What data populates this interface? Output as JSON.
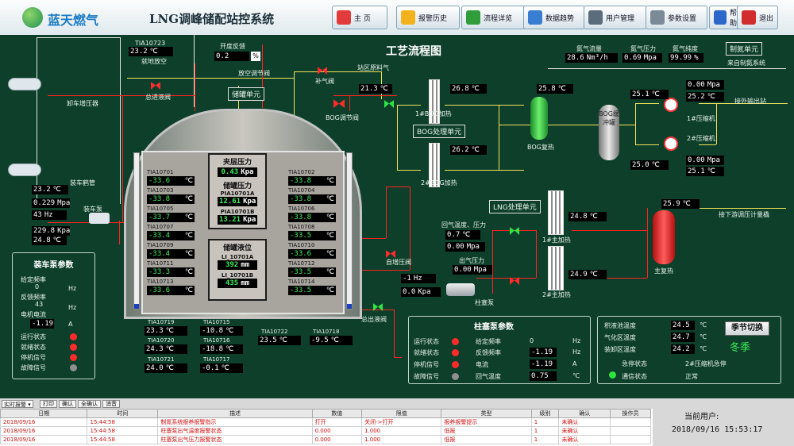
{
  "header": {
    "brand": "蓝天燃气",
    "title": "LNG调峰储配站控系统",
    "nav": [
      {
        "label": "主 页",
        "icon": "home-icon",
        "color": "#e23b3b"
      },
      {
        "label": "报警历史",
        "icon": "warning-icon",
        "color": "#f2b21b"
      },
      {
        "label": "流程详览",
        "icon": "process-icon",
        "color": "#2f9d3a"
      },
      {
        "label": "数据趋势",
        "icon": "trend-icon",
        "color": "#3a7ed1"
      },
      {
        "label": "用户管理",
        "icon": "user-icon",
        "color": "#5b6c7a"
      },
      {
        "label": "参数设置",
        "icon": "gear-icon",
        "color": "#7a8a96"
      },
      {
        "label": "帮助",
        "icon": "help-icon",
        "color": "#2d67c9"
      },
      {
        "label": "退出",
        "icon": "exit-icon",
        "color": "#d12d2d"
      }
    ]
  },
  "diagram": {
    "title": "工艺流程图",
    "tank_unit": "储罐单元",
    "bog_unit": "BOG处理单元",
    "lng_unit": "LNG处理单元",
    "n2_unit": "制氮单元",
    "n2_from": "来自制氮系统",
    "unload_press": "卸车增压器",
    "unload_arm": "装车鹤管",
    "unload_pump": "装车泵",
    "tank_valve": "总进液阀",
    "tank_out_valve": "总出液阀",
    "vent": "就地放空",
    "vent_valve": "放空调节阀",
    "aperture_label": "开度反馈",
    "aperture_val": "0.2",
    "aperture_unit": "%",
    "supp_valve": "补气阀",
    "bog_valve": "BOG调节阀",
    "station_gas": "站区原料气",
    "self_valve": "自增压阀",
    "bog1": "1#BOG加热",
    "bog2": "2#BOG加热",
    "bog_reheat": "BOG复热",
    "bog_tank": "BOG缓冲罐",
    "comp1": "1#压缩机",
    "comp2": "2#压缩机",
    "out_station": "接外输出站",
    "main_heat1": "1#主加热",
    "main_heat2": "2#主加热",
    "main_reheat": "主复热",
    "next_station": "接下游调压计量橇",
    "out_temp_press": "回气温度、压力",
    "out_press": "出气压力",
    "plunger": "柱塞泵",
    "tia10723": "TIA10723",
    "tia10723_val": "23.2",
    "n2_flow_lbl": "氮气流量",
    "n2_flow": "28.6",
    "n2_flow_u": "Nm³/h",
    "n2_press_lbl": "氮气压力",
    "n2_press": "0.69",
    "n2_press_u": "Mpa",
    "n2_pur_lbl": "氮气纯度",
    "n2_pur": "99.99",
    "n2_pur_u": "%"
  },
  "readings": {
    "r213": "21.3",
    "r268": "26.8",
    "r258": "25.8",
    "r262": "26.2",
    "r251": "25.1",
    "r252": "25.2",
    "r250": "25.0",
    "r251b": "25.1",
    "r000a": "0.00",
    "r000b": "0.00",
    "r259": "25.9",
    "r248": "24.8",
    "r249": "24.9",
    "r07": "0.7",
    "r000c": "0.00",
    "r000d": "0.00",
    "rm1": "-1",
    "r00": "0.0",
    "unload_temp": "23.2",
    "unload_press": "0.229",
    "unload_freq": "43",
    "pump_press": "229.8",
    "pump_temp": "24.8"
  },
  "tank": {
    "layer_title": "夹层压力",
    "layer_val": "0.43",
    "layer_u": "Kpa",
    "press_title": "储罐压力",
    "pia_a": "PIA10701A",
    "pia_a_val": "12.61",
    "pia_b": "PIA10701B",
    "pia_b_val": "13.21",
    "press_u": "Kpa",
    "level_title": "储罐液位",
    "li_a": "LI_10701A",
    "li_a_val": "392",
    "li_b": "LI_10701B",
    "li_b_val": "435",
    "level_u": "mm",
    "left": [
      {
        "tag": "TIA10701",
        "val": "-33.6"
      },
      {
        "tag": "TIA10703",
        "val": "-33.8"
      },
      {
        "tag": "TIA10705",
        "val": "-33.7"
      },
      {
        "tag": "TIA10707",
        "val": "-33.4"
      },
      {
        "tag": "TIA10709",
        "val": "-33.4"
      },
      {
        "tag": "TIA10711",
        "val": "-33.3"
      },
      {
        "tag": "TIA10713",
        "val": "-33.6"
      }
    ],
    "right": [
      {
        "tag": "TIA10702",
        "val": "-33.8"
      },
      {
        "tag": "TIA10704",
        "val": "-33.8"
      },
      {
        "tag": "TIA10706",
        "val": "-33.8"
      },
      {
        "tag": "TIA10708",
        "val": "-33.5"
      },
      {
        "tag": "TIA10710",
        "val": "-33.6"
      },
      {
        "tag": "TIA10712",
        "val": "-33.5"
      },
      {
        "tag": "TIA10714",
        "val": "-33.5"
      }
    ],
    "bottom": [
      {
        "tag": "TIA10719",
        "val": "23.3"
      },
      {
        "tag": "TIA10720",
        "val": "24.3"
      },
      {
        "tag": "TIA10721",
        "val": "24.0"
      },
      {
        "tag": "TIA10715",
        "val": "-10.8"
      },
      {
        "tag": "TIA10716",
        "val": "-18.8"
      },
      {
        "tag": "TIA10717",
        "val": "-0.1"
      },
      {
        "tag": "TIA10722",
        "val": "23.5"
      },
      {
        "tag": "TIA10718",
        "val": "-9.5"
      }
    ],
    "unit_c": "℃"
  },
  "load_pump": {
    "title": "装车泵参数",
    "given_freq": "给定频率",
    "given_val": "0",
    "fb_freq": "反馈频率",
    "fb_val": "43",
    "current": "电机电流",
    "current_val": "-1.19",
    "hz": "Hz",
    "amp": "A",
    "run": "运行状态",
    "ready": "就绪状态",
    "stop": "停机信号",
    "fault": "故障信号"
  },
  "plunger_pump": {
    "title": "柱塞泵参数",
    "run": "运行状态",
    "ready": "就绪状态",
    "stop": "停机信号",
    "fault": "故障信号",
    "given": "给定频率",
    "given_val": "0",
    "fb": "反馈频率",
    "fb_val": "-1.19",
    "cur": "电流",
    "cur_val": "-1.19",
    "gas_temp": "回气温度",
    "gas_temp_val": "0.75",
    "hz": "Hz",
    "amp": "A",
    "c": "℃"
  },
  "season": {
    "pool_temp": "积液池温度",
    "pool_val": "24.5",
    "gas_temp": "气化区温度",
    "gas_val": "24.7",
    "load_temp": "装卸区温度",
    "load_val": "24.2",
    "c": "℃",
    "btn": "季节切换",
    "cur": "冬季",
    "emergency": "急停状态",
    "emergency_val": "2#压缩机急停",
    "comm": "通信状态",
    "comm_val": "正常"
  },
  "alarm": {
    "mode": "实时报警",
    "buttons": [
      "打印",
      "确认",
      "全确认",
      "消音"
    ],
    "columns": [
      "日期",
      "时间",
      "描述",
      "数值",
      "限值",
      "类型",
      "级别",
      "确认",
      "操作员"
    ],
    "rows": [
      [
        "2018/09/16",
        "15:44:58",
        "制氮系统报养报警指示",
        "打开",
        "关闭->打开",
        "报养报警提示",
        "1",
        "未确认",
        ""
      ],
      [
        "2018/09/16",
        "15:44:58",
        "柱塞泵出气温度报警状态",
        "0.000",
        "1.000",
        "低报",
        "1",
        "未确认",
        ""
      ],
      [
        "2018/09/16",
        "15:44:58",
        "柱塞泵出气压力报警状态",
        "0.000",
        "1.000",
        "低报",
        "1",
        "未确认",
        ""
      ]
    ],
    "current_user": "当前用户:",
    "datetime": "2018/09/16 15:53:17"
  }
}
